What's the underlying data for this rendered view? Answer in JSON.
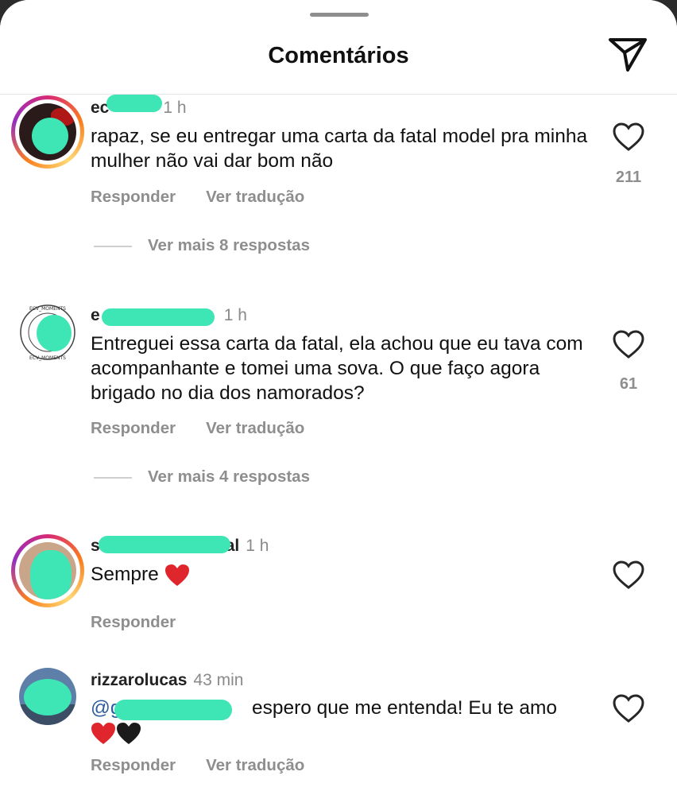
{
  "header": {
    "title": "Comentários",
    "share_icon": "send-icon"
  },
  "comments": [
    {
      "username_visible": "ec",
      "username_tail": "",
      "time": "1 h",
      "text": "rapaz, se eu entregar uma carta da fatal model pra minha mulher não vai dar bom não",
      "likes": "211",
      "reply_label": "Responder",
      "translate_label": "Ver tradução",
      "view_more": "Ver mais 8 respostas"
    },
    {
      "username_visible": "e",
      "username_tail": "",
      "time": "1 h",
      "text": "Entreguei essa carta da fatal, ela achou que eu tava com acompanhante e tomei uma sova. O que faço agora brigado no dia dos namorados?",
      "likes": "61",
      "reply_label": "Responder",
      "translate_label": "Ver tradução",
      "view_more": "Ver mais 4 respostas",
      "avatar_ring_text": "ECV_MOMENTS • ECV_MOMENTS •"
    },
    {
      "username_visible": "s",
      "username_tail": "al",
      "time": "1 h",
      "text": "Sempre",
      "reply_label": "Responder"
    },
    {
      "username_visible": "rizzarolucas",
      "time": "43 min",
      "mention": "@gg",
      "text": "espero que me entenda! Eu te amo",
      "reply_label": "Responder",
      "translate_label": "Ver tradução"
    }
  ],
  "colors": {
    "accent_ring": "#d62976",
    "redaction": "#3ee6b5",
    "muted": "#8e8e8e",
    "mention": "#2b5d9e"
  }
}
